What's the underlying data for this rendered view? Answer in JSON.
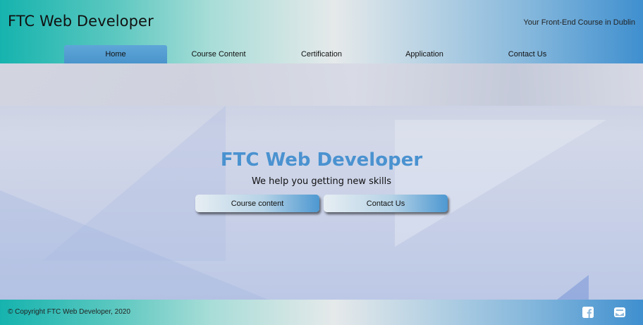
{
  "header": {
    "site_title": "FTC Web Developer",
    "tagline": "Your Front-End Course in Dublin"
  },
  "nav": {
    "items": [
      {
        "label": "Home",
        "active": true
      },
      {
        "label": "Course Content",
        "active": false
      },
      {
        "label": "Certification",
        "active": false
      },
      {
        "label": "Application",
        "active": false
      },
      {
        "label": "Contact Us",
        "active": false
      }
    ]
  },
  "hero": {
    "title": "FTC Web Developer",
    "subtitle": "We help you getting new skills",
    "buttons": [
      {
        "label": "Course content"
      },
      {
        "label": "Contact Us"
      }
    ]
  },
  "footer": {
    "copyright": "© Copyright FTC Web Developer, 2020",
    "social_icons": [
      "facebook-icon",
      "email-icon"
    ]
  },
  "colors": {
    "accent": "#4a92d0",
    "teal": "#16b3ae",
    "blue": "#3f8fcf"
  }
}
